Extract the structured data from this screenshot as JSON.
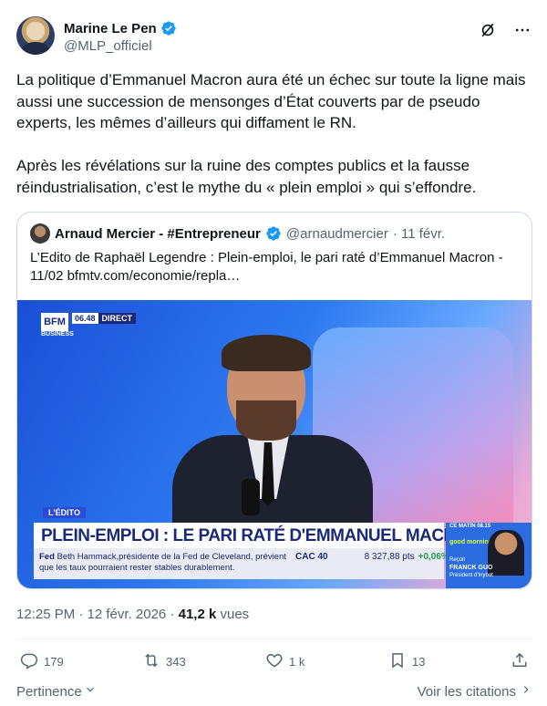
{
  "author": {
    "name": "Marine Le Pen",
    "handle": "@MLP_officiel",
    "verified": true
  },
  "tweet": {
    "paragraphs": [
      "La politique d’Emmanuel Macron aura été un échec sur toute la ligne mais aussi une succession de mensonges d’État couverts par de pseudo experts, les mêmes d’ailleurs qui diffament le RN.",
      "Après les révélations sur la ruine des comptes publics et la fausse réindustrialisation, c’est le mythe du « plein emploi » qui s’effondre."
    ]
  },
  "quote": {
    "name": "Arnaud Mercier - #Entrepreneur",
    "handle": "@arnaudmercier",
    "date": "· 11 févr.",
    "text": "L’Edito de Raphaël Legendre : Plein-emploi, le pari raté d’Emmanuel Macron - 11/02 bfmtv.com/economie/repla…",
    "media": {
      "logo": "BFM",
      "logo_sub": "BUSINESS",
      "time": "06.48",
      "live": "DIRECT",
      "tag": "L'ÉDITO",
      "headline": "PLEIN-EMPLOI : LE PARI RATÉ D'EMMANUEL MACRON",
      "ticker_source": "Fed",
      "ticker_text": "Beth Hammack,présidente de la Fed de Cleveland, prévient que les taux pourraient rester stables durablement.",
      "index_name": "CAC 40",
      "index_value": "8 327,88 pts",
      "index_change": "+0,06%",
      "show_label": "CE MATIN 08.15",
      "show_logo": "good morning",
      "guest_intro": "Reçoit",
      "guest_name": "FRANCK GUO",
      "guest_role": "Président d'Inybot"
    }
  },
  "meta": {
    "time": "12:25 PM · 12 févr. 2026 · ",
    "views_count": "41,2 k",
    "views_label": " vues"
  },
  "actions": {
    "replies": "179",
    "reposts": "343",
    "likes": "1 k",
    "bookmarks": "13"
  },
  "footer": {
    "sort_label": "Pertinence",
    "citations_label": "Voir les citations"
  },
  "colors": {
    "verified": "#1d9bf0",
    "text": "#0f1419",
    "muted": "#536471",
    "border": "#cfd9de"
  },
  "icons": [
    "verified-badge-icon",
    "grok-icon",
    "more-icon",
    "reply-icon",
    "repost-icon",
    "like-icon",
    "bookmark-icon",
    "share-icon",
    "chevron-down-icon",
    "chevron-right-icon"
  ]
}
